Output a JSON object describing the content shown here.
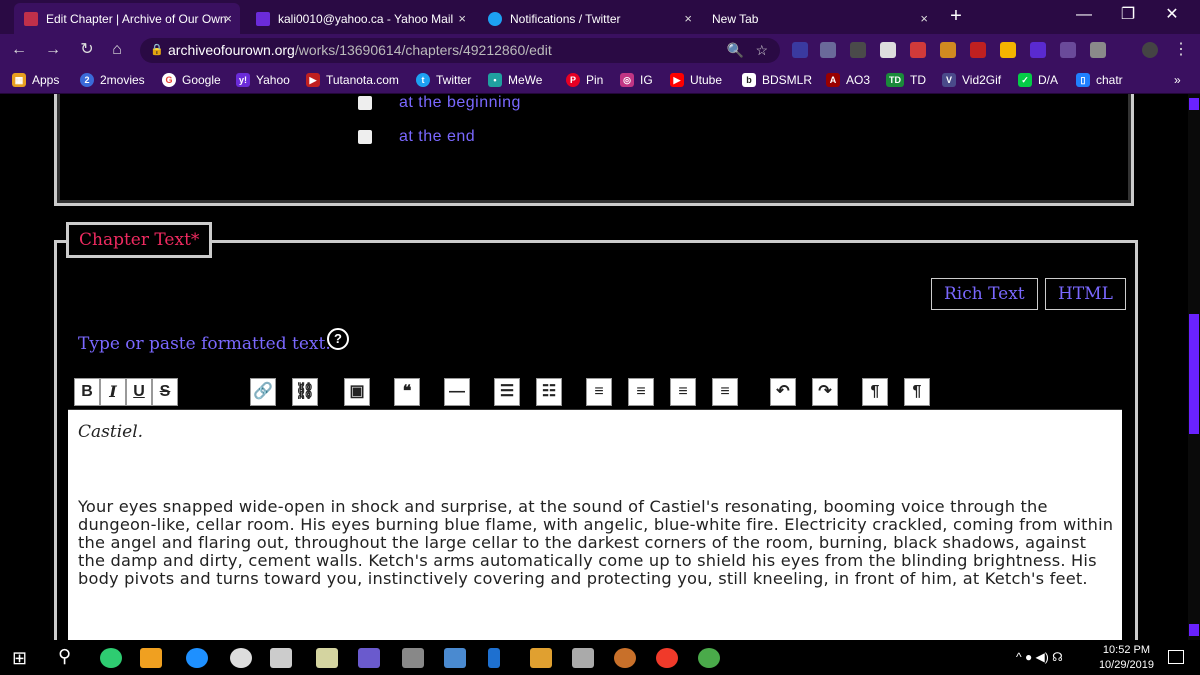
{
  "tabs": [
    {
      "title": "Edit Chapter | Archive of Our Own",
      "close": "×",
      "fav": "#c0304a"
    },
    {
      "title": "kali0010@yahoo.ca - Yahoo Mail",
      "close": "×",
      "fav": "#6b2bd9"
    },
    {
      "title": "Notifications / Twitter",
      "close": "×",
      "fav": "#1da1f2"
    },
    {
      "title": "New Tab",
      "close": "×",
      "fav": ""
    }
  ],
  "window": {
    "new_tab": "+",
    "minimize": "—",
    "maximize": "❐",
    "close": "✕"
  },
  "address": {
    "back": "←",
    "forward": "→",
    "reload": "↻",
    "home": "⌂",
    "host": "archiveofourown.org",
    "path": "/works/13690614/chapters/49212860/edit",
    "lock": "🔒",
    "zoom": "🔍",
    "star": "☆",
    "menu": "⋮"
  },
  "bookmarks": [
    {
      "label": "Apps",
      "icon": "▦",
      "color": "#e8a020"
    },
    {
      "label": "2movies",
      "icon": "2",
      "color": "#3a6bd9"
    },
    {
      "label": "Google",
      "icon": "G",
      "color": "#ea4335"
    },
    {
      "label": "Yahoo",
      "icon": "y!",
      "color": "#6b2bd9"
    },
    {
      "label": "Tutanota.com",
      "icon": "▶",
      "color": "#c02020"
    },
    {
      "label": "Twitter",
      "icon": "t",
      "color": "#1da1f2"
    },
    {
      "label": "MeWe",
      "icon": "•",
      "color": "#20a0a0"
    },
    {
      "label": "Pin",
      "icon": "P",
      "color": "#e60023"
    },
    {
      "label": "IG",
      "icon": "◎",
      "color": "#c13584"
    },
    {
      "label": "Utube",
      "icon": "▶",
      "color": "#ff0000"
    },
    {
      "label": "BDSMLR",
      "icon": "b",
      "color": "#222"
    },
    {
      "label": "AO3",
      "icon": "A",
      "color": "#990000"
    },
    {
      "label": "TD",
      "icon": "TD",
      "color": "#1a8a3a"
    },
    {
      "label": "Vid2Gif",
      "icon": "V",
      "color": "#4a4a8a"
    },
    {
      "label": "D/A",
      "icon": "✓",
      "color": "#05cc47"
    },
    {
      "label": "chatr",
      "icon": "▯",
      "color": "#2080ff"
    }
  ],
  "bookmarks_more": "»",
  "position": {
    "title": "",
    "options": [
      "at the beginning",
      "at the end"
    ],
    "checked": [
      false,
      false
    ]
  },
  "chapter": {
    "legend": "Chapter Text*",
    "rich_text": "Rich Text",
    "html": "HTML",
    "hint": "Type or paste formatted text.",
    "help": "?",
    "toolbar": [
      "B",
      "I",
      "U",
      "S",
      "🔗",
      "⛓",
      "▣",
      "❝",
      "—",
      "☰",
      "☷",
      "≡",
      "≡",
      "≡",
      "≡",
      "↶",
      "↷",
      "¶",
      "¶"
    ],
    "name": "Castiel.",
    "paragraph": "Your eyes snapped wide-open in shock and surprise, at the sound of Castiel's resonating, booming voice through the dungeon-like, cellar room. His eyes burning blue flame, with angelic, blue-white fire. Electricity crackled, coming from within the angel and flaring out, throughout the large cellar to the darkest corners of the room, burning, black shadows, against the damp and dirty, cement walls. Ketch's arms automatically come up to shield his eyes from the blinding brightness. His body pivots and turns toward you, instinctively covering and protecting you, still kneeling, in front of him, at Ketch's feet."
  },
  "taskbar": {
    "time": "10:52 PM",
    "date": "10/29/2019",
    "start": "⊞",
    "search": "⚲",
    "tray": "^ ● ◀) ☊"
  },
  "colors": {
    "accent": "#7a68ff",
    "legend": "#ee2a60",
    "tabbar": "#2a0a44",
    "chrome": "#3a1060"
  }
}
